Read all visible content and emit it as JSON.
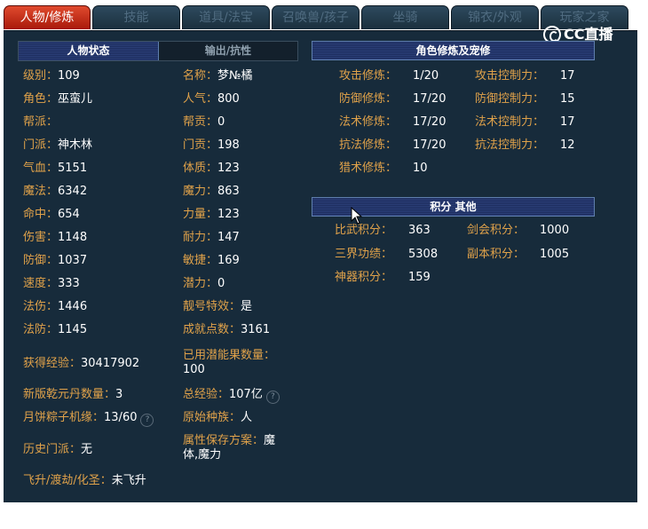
{
  "tabs": [
    "人物/修炼",
    "技能",
    "道具/法宝",
    "召唤兽/孩子",
    "坐骑",
    "锦衣/外观",
    "玩家之家"
  ],
  "logo_text": "CC直播",
  "status_tabs": {
    "active": "人物状态",
    "inactive": "输出/抗性"
  },
  "cultivation_header": "角色修炼及宠修",
  "points_header": "积分  其他",
  "left_col": [
    {
      "label": "级别：",
      "value": "109"
    },
    {
      "label": "角色：",
      "value": "巫蛮儿"
    },
    {
      "label": "帮派：",
      "value": ""
    },
    {
      "label": "门派：",
      "value": "神木林"
    },
    {
      "label": "气血：",
      "value": "5151"
    },
    {
      "label": "魔法：",
      "value": "6342"
    },
    {
      "label": "命中：",
      "value": "654"
    },
    {
      "label": "伤害：",
      "value": "1148"
    },
    {
      "label": "防御：",
      "value": "1037"
    },
    {
      "label": "速度：",
      "value": "333"
    },
    {
      "label": "法伤：",
      "value": "1446"
    },
    {
      "label": "法防：",
      "value": "1145"
    }
  ],
  "right_col": [
    {
      "label": "名称：",
      "value": "梦№橘"
    },
    {
      "label": "人气：",
      "value": "800"
    },
    {
      "label": "帮贡：",
      "value": "0"
    },
    {
      "label": "门贡：",
      "value": "198"
    },
    {
      "label": "体质：",
      "value": "123"
    },
    {
      "label": "魔力：",
      "value": "863"
    },
    {
      "label": "力量：",
      "value": "123"
    },
    {
      "label": "耐力：",
      "value": "147"
    },
    {
      "label": "敏捷：",
      "value": "169"
    },
    {
      "label": "潜力：",
      "value": "0"
    },
    {
      "label": "靓号特效：",
      "value": "是"
    },
    {
      "label": "成就点数：",
      "value": "3161"
    }
  ],
  "extra": {
    "exp_label": "获得经验：",
    "exp_value": "30417902",
    "potion_label": "已用潜能果数量：",
    "potion_value": "100",
    "qianyuan_label": "新版乾元丹数量：",
    "qianyuan_value": "3",
    "total_exp_label": "总经验：",
    "total_exp_value": "107亿",
    "zongzi_label": "月饼粽子机缘：",
    "zongzi_value": "13/60",
    "race_label": "原始种族：",
    "race_value": "人",
    "history_label": "历史门派：",
    "history_value": "无",
    "attr_label": "属性保存方案：",
    "attr_value": "魔体,魔力",
    "ascend_label": "飞升/渡劫/化圣：",
    "ascend_value": "未飞升"
  },
  "help_glyph": "?",
  "cultivation": [
    {
      "label": "攻击修炼：",
      "value": "1/20",
      "label2": "攻击控制力：",
      "value2": "17"
    },
    {
      "label": "防御修炼：",
      "value": "17/20",
      "label2": "防御控制力：",
      "value2": "15"
    },
    {
      "label": "法术修炼：",
      "value": "17/20",
      "label2": "法术控制力：",
      "value2": "17"
    },
    {
      "label": "抗法修炼：",
      "value": "17/20",
      "label2": "抗法控制力：",
      "value2": "12"
    },
    {
      "label": "猎术修炼：",
      "value": "10",
      "label2": "",
      "value2": ""
    }
  ],
  "points": [
    {
      "label": "比武积分：",
      "value": "363",
      "label2": "剑会积分：",
      "value2": "1000"
    },
    {
      "label": "三界功绩：",
      "value": "5308",
      "label2": "副本积分：",
      "value2": "1005"
    },
    {
      "label": "神器积分：",
      "value": "159",
      "label2": "",
      "value2": ""
    }
  ]
}
